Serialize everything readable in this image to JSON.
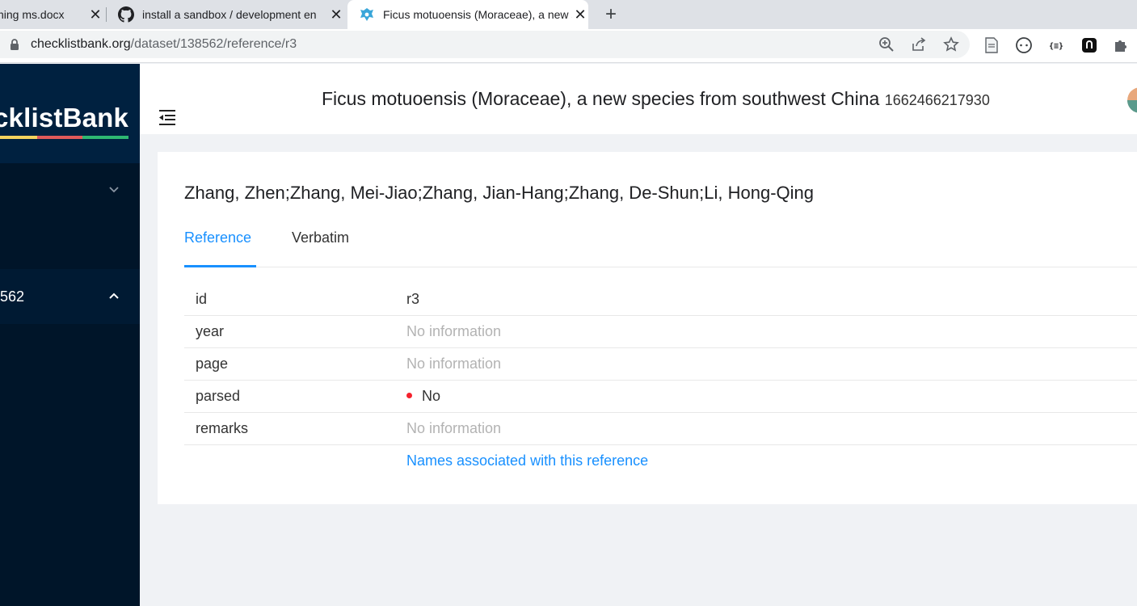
{
  "browser": {
    "tabs": [
      {
        "title": "shing ms.docx",
        "active": false
      },
      {
        "title": "install a sandbox / development en",
        "active": false
      },
      {
        "title": "Ficus motuoensis (Moraceae), a new species",
        "active": true
      }
    ],
    "url_host": "checklistbank.org",
    "url_path": "/dataset/138562/reference/r3",
    "toolbar_icons": [
      "zoom-icon",
      "share-icon",
      "bookmark-star-icon",
      "document-extension-icon",
      "circle-extension-icon",
      "json-extension-icon",
      "black-extension-icon",
      "puzzle-extensions-icon"
    ]
  },
  "sidebar": {
    "logo_text": "cklistBank",
    "stripe_colors": [
      "#f4d35e",
      "#e05a5a",
      "#2eb872"
    ],
    "items": [
      {
        "label": "",
        "expanded": false
      },
      {
        "label": "562",
        "expanded": true
      }
    ]
  },
  "header": {
    "title": "Ficus motuoensis (Moraceae), a new species from southwest China",
    "timestamp": "1662466217930"
  },
  "reference": {
    "authors": "Zhang, Zhen;Zhang, Mei-Jiao;Zhang, Jian-Hang;Zhang, De-Shun;Li, Hong-Qing",
    "tabs": [
      {
        "label": "Reference",
        "active": true
      },
      {
        "label": "Verbatim",
        "active": false
      }
    ],
    "fields": [
      {
        "key": "id",
        "value": "r3"
      },
      {
        "key": "year",
        "value": "No information"
      },
      {
        "key": "page",
        "value": "No information"
      },
      {
        "key": "parsed",
        "value": "No"
      },
      {
        "key": "remarks",
        "value": "No information"
      }
    ],
    "names_link": "Names associated with this reference",
    "colors": {
      "accent": "#1890ff",
      "negative": "#f5222d",
      "muted": "#b3b3b3"
    }
  }
}
